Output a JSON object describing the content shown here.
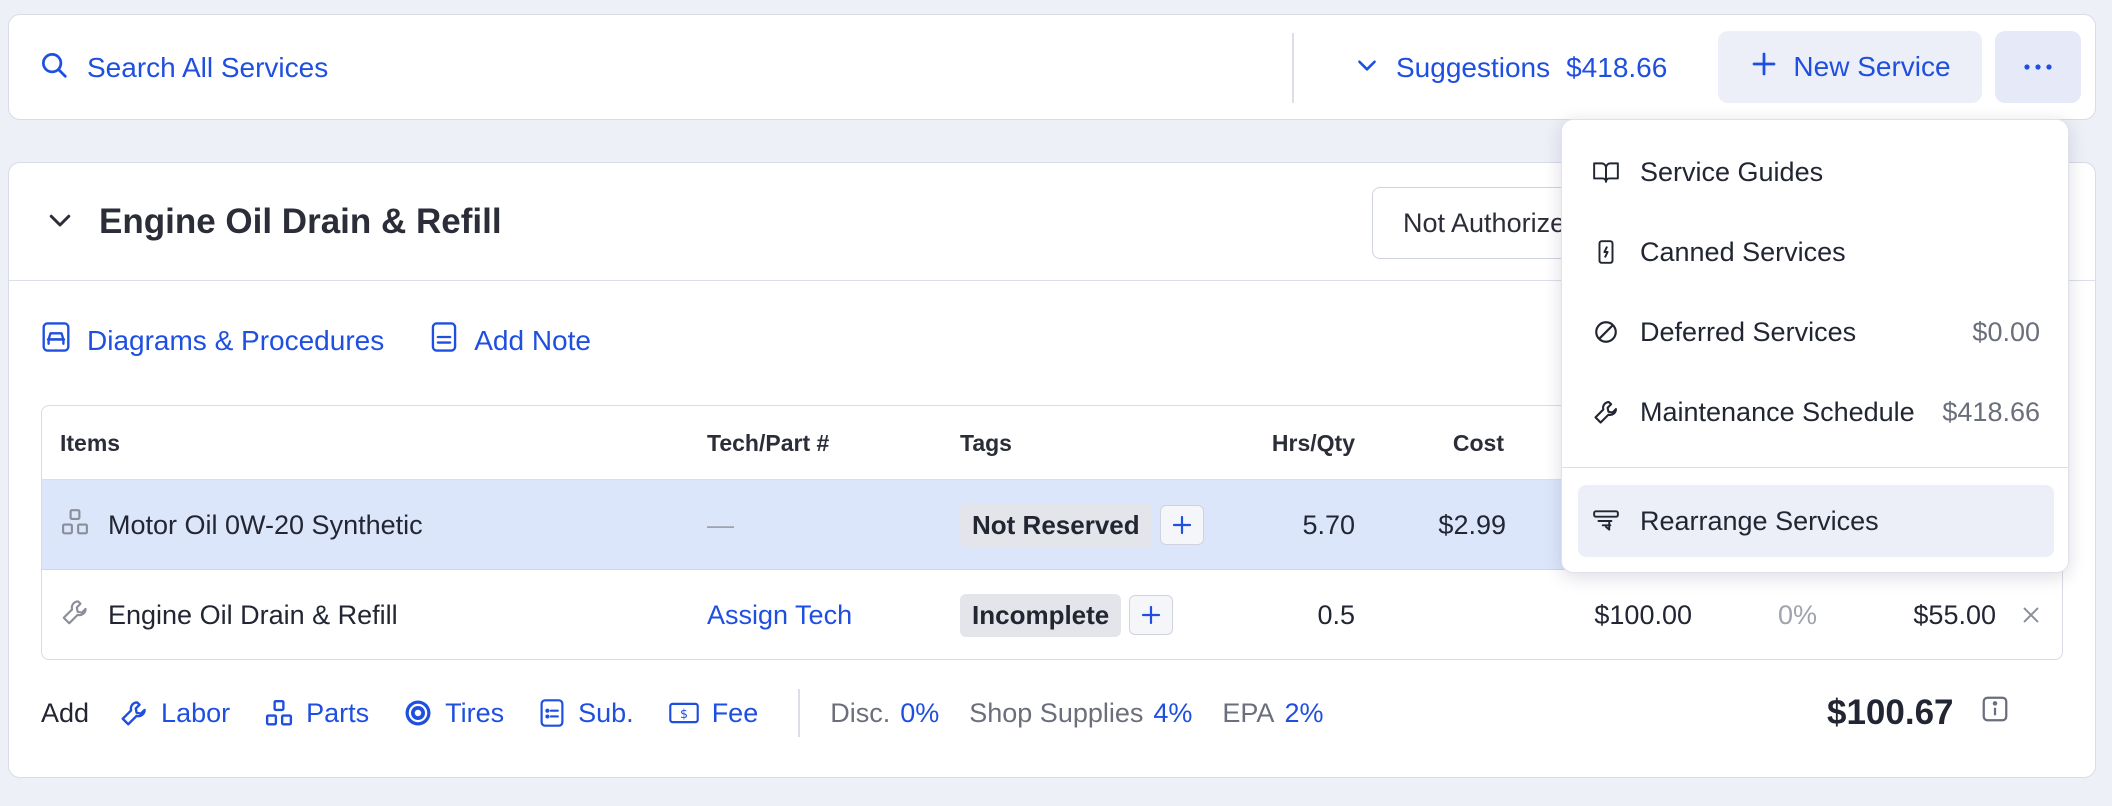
{
  "topbar": {
    "search_label": "Search All Services",
    "suggestions_label": "Suggestions",
    "suggestions_amount": "$418.66",
    "new_service_label": "New Service"
  },
  "service": {
    "title": "Engine Oil Drain & Refill",
    "authorization": "Not Authorized",
    "links": {
      "diagrams": "Diagrams & Procedures",
      "add_note": "Add Note"
    },
    "table": {
      "headers": {
        "items": "Items",
        "tech_part": "Tech/Part #",
        "tags": "Tags",
        "hrs_qty": "Hrs/Qty",
        "cost": "Cost"
      },
      "rows": [
        {
          "item": "Motor Oil 0W-20 Synthetic",
          "tech_part": "—",
          "tag": "Not Reserved",
          "hrs_qty": "5.70",
          "cost": "$2.99",
          "price": "",
          "disc": "",
          "total": ""
        },
        {
          "item": "Engine Oil Drain & Refill",
          "tech_part": "Assign Tech",
          "tag": "Incomplete",
          "hrs_qty": "0.5",
          "cost": "",
          "price": "$100.00",
          "disc": "0%",
          "total": "$55.00"
        }
      ]
    },
    "footer": {
      "add_label": "Add",
      "labor": "Labor",
      "parts": "Parts",
      "tires": "Tires",
      "sub": "Sub.",
      "fee": "Fee",
      "disc_label": "Disc.",
      "disc_value": "0%",
      "shop_supplies_label": "Shop Supplies",
      "shop_supplies_value": "4%",
      "epa_label": "EPA",
      "epa_value": "2%",
      "total": "$100.67"
    }
  },
  "menu": {
    "items": [
      {
        "label": "Service Guides",
        "value": ""
      },
      {
        "label": "Canned Services",
        "value": ""
      },
      {
        "label": "Deferred Services",
        "value": "$0.00"
      },
      {
        "label": "Maintenance Schedule",
        "value": "$418.66"
      },
      {
        "label": "Rearrange Services",
        "value": ""
      }
    ]
  },
  "colors": {
    "accent": "#1f4fe0",
    "selected_row": "#dce6fb",
    "background": "#eef0f8"
  }
}
